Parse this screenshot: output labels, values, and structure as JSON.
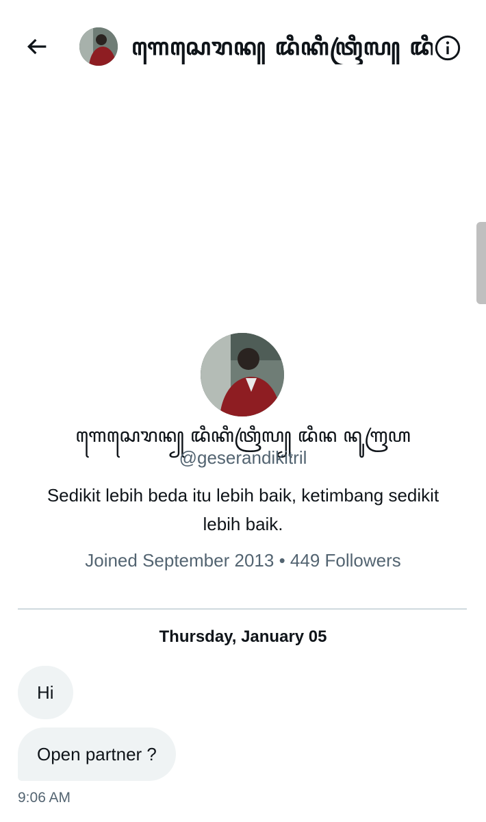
{
  "header": {
    "title": "ꦒꦺꦱꦺꦫꦤ꧀ ꦢꦶꦏꦶꦠꦿꦶꦭ꧀ ꦢꦶꦤ ꦤꦸꦒꦿꦲ",
    "back_icon": "arrow-left-icon",
    "info_icon": "info-circle-icon"
  },
  "profile": {
    "display_name": "ꦒꦺꦱꦺꦫꦤ꧀ ꦢꦶꦏꦶꦠꦿꦶꦭ꧀ ꦢꦶꦤ ꦤꦸꦒꦿꦲ",
    "handle": "@geserandikitril",
    "bio": "Sedikit lebih beda itu lebih baik, ketimbang sedikit lebih baik.",
    "joined": "Joined September 2013",
    "separator": "•",
    "followers": "449 Followers"
  },
  "conversation": {
    "date": "Thursday, January 05",
    "messages": [
      {
        "text": "Hi"
      },
      {
        "text": "Open partner ?"
      }
    ],
    "last_time": "9:06 AM"
  },
  "colors": {
    "text": "#0f1419",
    "secondary": "#536471",
    "bubble": "#eff3f4",
    "divider": "#cfd9de"
  }
}
